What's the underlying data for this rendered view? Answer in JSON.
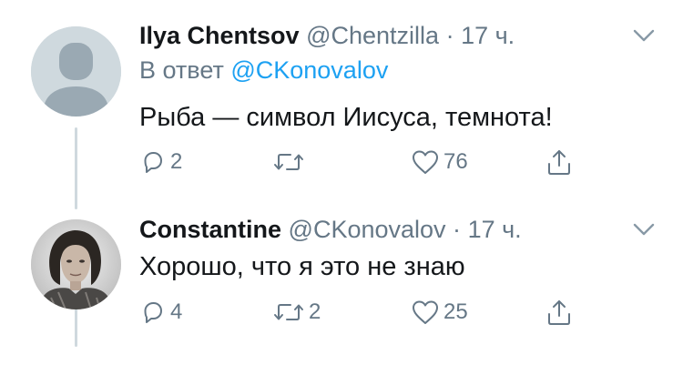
{
  "tweets": [
    {
      "name": "Ilya Chentsov",
      "handle": "@Chentzilla",
      "separator": "·",
      "time": "17 ч.",
      "reply_prefix": "В ответ",
      "reply_to": "@CKonovalov",
      "text": "Рыба — символ Иисуса, темнота!",
      "replies": "2",
      "retweets": "",
      "likes": "76"
    },
    {
      "name": "Constantine",
      "handle": "@CKonovalov",
      "separator": "·",
      "time": "17 ч.",
      "text": "Хорошо, что я это не знаю",
      "replies": "4",
      "retweets": "2",
      "likes": "25"
    }
  ],
  "colors": {
    "link": "#1da1f2",
    "muted": "#657786",
    "text": "#14171a",
    "thread_line": "#cfd9de"
  },
  "icons": [
    "chevron-down-icon",
    "reply-icon",
    "retweet-icon",
    "like-icon",
    "share-icon"
  ]
}
